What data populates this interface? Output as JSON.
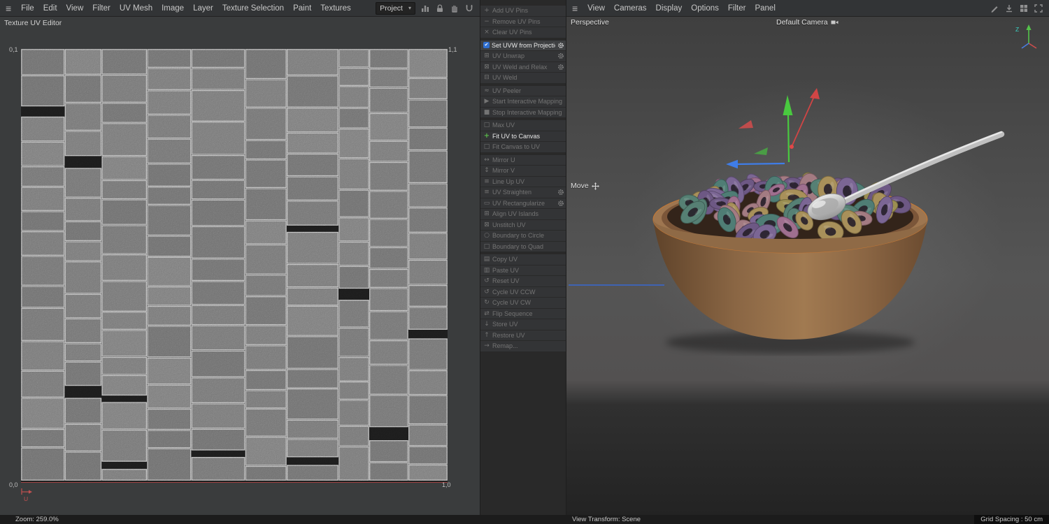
{
  "uv_editor": {
    "menu": [
      "File",
      "Edit",
      "View",
      "Filter",
      "UV Mesh",
      "Image",
      "Layer",
      "Texture Selection",
      "Paint",
      "Textures"
    ],
    "title": "Texture UV Editor",
    "project_dropdown": "Project",
    "corners": {
      "top_left": "0,1",
      "top_right": "1,1",
      "bottom_left": "0,0",
      "bottom_right": "1,0"
    },
    "u_axis_label": "U",
    "zoom_status": "Zoom: 259.0%"
  },
  "uv_panel": {
    "groups": [
      {
        "items": [
          {
            "label": "Add UV Pins",
            "icon": "pin-add",
            "enabled": false,
            "gear": false
          },
          {
            "label": "Remove UV Pins",
            "icon": "pin-remove",
            "enabled": false,
            "gear": false
          },
          {
            "label": "Clear UV Pins",
            "icon": "pin-clear",
            "enabled": false,
            "gear": false
          }
        ]
      },
      {
        "items": [
          {
            "label": "Set UVW from Projection",
            "icon": "projection-check",
            "enabled": true,
            "highlight": true,
            "gear": true
          },
          {
            "label": "UV Unwrap",
            "icon": "unwrap",
            "enabled": false,
            "gear": true
          },
          {
            "label": "UV Weld and Relax",
            "icon": "weld-relax",
            "enabled": false,
            "gear": true
          },
          {
            "label": "UV Weld",
            "icon": "weld",
            "enabled": false,
            "gear": false
          }
        ]
      },
      {
        "items": [
          {
            "label": "UV Peeler",
            "icon": "peeler",
            "enabled": false,
            "gear": false
          },
          {
            "label": "Start Interactive Mapping",
            "icon": "play",
            "enabled": false,
            "gear": false
          },
          {
            "label": "Stop Interactive Mapping",
            "icon": "stop",
            "enabled": false,
            "gear": false
          }
        ]
      },
      {
        "items": [
          {
            "label": "Max UV",
            "icon": "max",
            "enabled": false,
            "gear": false
          },
          {
            "label": "Fit UV to Canvas",
            "icon": "fit-plus",
            "enabled": true,
            "gear": false
          },
          {
            "label": "Fit Canvas to UV",
            "icon": "fit-canvas",
            "enabled": false,
            "gear": false
          }
        ]
      },
      {
        "items": [
          {
            "label": "Mirror U",
            "icon": "mirror-u",
            "enabled": false,
            "gear": false
          },
          {
            "label": "Mirror V",
            "icon": "mirror-v",
            "enabled": false,
            "gear": false
          },
          {
            "label": "Line Up UV",
            "icon": "lineup",
            "enabled": false,
            "gear": false
          },
          {
            "label": "UV Straighten",
            "icon": "straighten",
            "enabled": false,
            "gear": true
          },
          {
            "label": "UV Rectangularize",
            "icon": "rectangularize",
            "enabled": false,
            "gear": true
          },
          {
            "label": "Align UV Islands",
            "icon": "align",
            "enabled": false,
            "gear": false
          },
          {
            "label": "Unstitch UV",
            "icon": "unstitch",
            "enabled": false,
            "gear": false
          },
          {
            "label": "Boundary to Circle",
            "icon": "circle",
            "enabled": false,
            "gear": false
          },
          {
            "label": "Boundary to Quad",
            "icon": "quad",
            "enabled": false,
            "gear": false
          }
        ]
      },
      {
        "items": [
          {
            "label": "Copy UV",
            "icon": "copy",
            "enabled": false,
            "gear": false
          },
          {
            "label": "Paste UV",
            "icon": "paste",
            "enabled": false,
            "gear": false
          },
          {
            "label": "Reset UV",
            "icon": "reset",
            "enabled": false,
            "gear": false
          },
          {
            "label": "Cycle UV CCW",
            "icon": "ccw",
            "enabled": false,
            "gear": false
          },
          {
            "label": "Cycle UV CW",
            "icon": "cw",
            "enabled": false,
            "gear": false
          },
          {
            "label": "Flip Sequence",
            "icon": "flip",
            "enabled": false,
            "gear": false
          },
          {
            "label": "Store UV",
            "icon": "store",
            "enabled": false,
            "gear": false
          },
          {
            "label": "Restore UV",
            "icon": "restore",
            "enabled": false,
            "gear": false
          },
          {
            "label": "Remap...",
            "icon": "remap",
            "enabled": false,
            "gear": false
          }
        ]
      }
    ]
  },
  "viewport": {
    "menu": [
      "View",
      "Cameras",
      "Display",
      "Options",
      "Filter",
      "Panel"
    ],
    "projection_label": "Perspective",
    "camera_label": "Default Camera",
    "tool_label": "Move",
    "axis_gizmo_label": "Z",
    "view_transform": "View Transform: Scene",
    "grid_spacing": "Grid Spacing : 50 cm"
  },
  "colors": {
    "projection_icon_blue": "#2f6fd0",
    "fit_icon_green": "#59b84a",
    "axis_red": "#d04545",
    "axis_green": "#49c93f",
    "axis_blue": "#3f7de8",
    "u_axis_red": "#c05050"
  }
}
